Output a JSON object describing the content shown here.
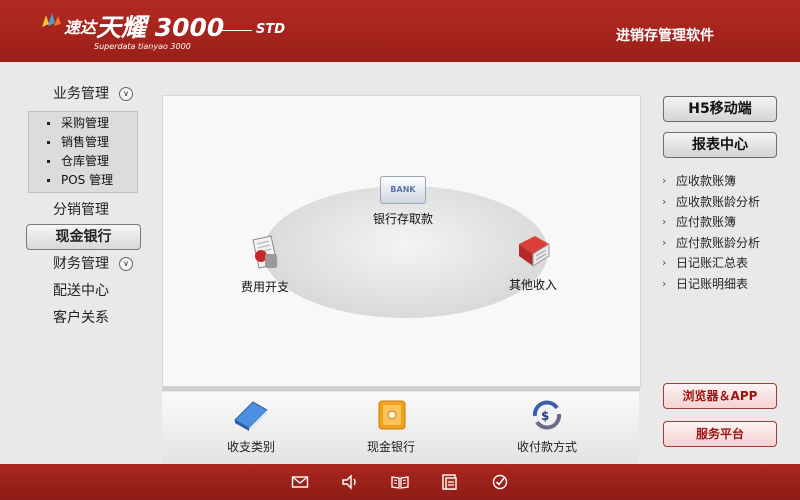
{
  "header": {
    "brand_cn": "速达",
    "brand_main": "天耀 3000",
    "brand_sub": "Superdata tianyao 3000",
    "edition": "STD",
    "tagline": "进销存管理软件"
  },
  "sidebar": {
    "items": [
      {
        "label": "业务管理",
        "expandable": true
      },
      {
        "label": "分销管理"
      },
      {
        "label": "现金银行",
        "active": true
      },
      {
        "label": "财务管理",
        "expandable": true
      },
      {
        "label": "配送中心"
      },
      {
        "label": "客户关系"
      }
    ],
    "submenu": [
      "采购管理",
      "销售管理",
      "仓库管理",
      "POS 管理"
    ]
  },
  "main": {
    "nodes": {
      "bank": {
        "label": "银行存取款",
        "badge": "BANK",
        "icon": "bank-card-icon"
      },
      "expense": {
        "label": "费用开支",
        "icon": "expense-document-icon"
      },
      "income": {
        "label": "其他收入",
        "icon": "income-book-icon"
      }
    },
    "tools": [
      {
        "label": "收支类别",
        "icon": "book-icon"
      },
      {
        "label": "现金银行",
        "icon": "safe-icon"
      },
      {
        "label": "收付款方式",
        "icon": "payment-cycle-icon"
      }
    ]
  },
  "right": {
    "h5_label": "H5移动端",
    "report_label": "报表中心",
    "reports": [
      "应收款账簿",
      "应收款账龄分析",
      "应付款账簿",
      "应付款账龄分析",
      "日记账汇总表",
      "日记账明细表"
    ],
    "browser_app_label": "浏览器＆APP",
    "service_label": "服务平台"
  },
  "footer": {
    "icons": [
      "mail-icon",
      "speaker-icon",
      "help-book-icon",
      "news-icon",
      "check-icon"
    ]
  },
  "colors": {
    "brand_red": "#9c1f19",
    "panel_bg": "#f8f8f8",
    "page_bg": "#e9e9e9"
  }
}
